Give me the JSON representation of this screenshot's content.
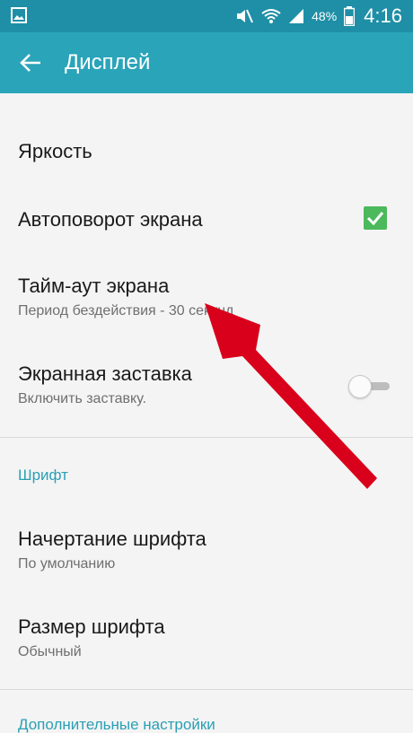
{
  "status_bar": {
    "battery_percent": "48%",
    "time": "4:16"
  },
  "header": {
    "title": "Дисплей"
  },
  "settings": {
    "brightness": {
      "title": "Яркость"
    },
    "auto_rotate": {
      "title": "Автоповорот экрана",
      "checked": true
    },
    "screen_timeout": {
      "title": "Тайм-аут экрана",
      "subtitle": "Период бездействия - 30 секунд"
    },
    "screensaver": {
      "title": "Экранная заставка",
      "subtitle": "Включить заставку.",
      "enabled": false
    }
  },
  "font_section": {
    "header": "Шрифт",
    "font_style": {
      "title": "Начертание шрифта",
      "subtitle": "По умолчанию"
    },
    "font_size": {
      "title": "Размер шрифта",
      "subtitle": "Обычный"
    }
  },
  "advanced_section": {
    "header": "Дополнительные настройки"
  },
  "colors": {
    "statusbar": "#1e8fa6",
    "actionbar": "#2aa4b9",
    "accent": "#2a9fb5",
    "checkbox": "#4cb95c",
    "arrow": "#d9001b"
  }
}
